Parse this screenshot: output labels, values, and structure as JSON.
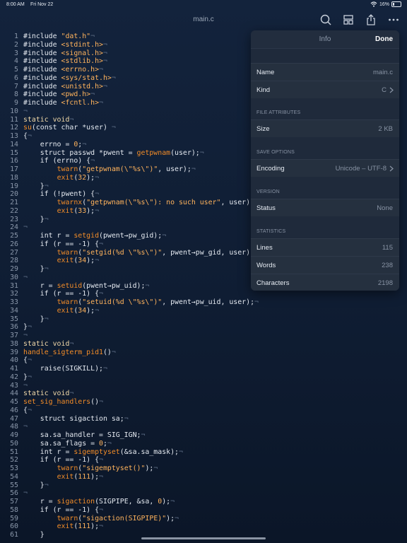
{
  "status_bar": {
    "time": "8:00 AM",
    "date": "Fri Nov 22",
    "battery": "16%",
    "battery_level": 0.16
  },
  "titlebar": {
    "title": "main.c",
    "icons": [
      "search-icon",
      "layout-icon",
      "share-icon",
      "more-icon"
    ]
  },
  "editor": {
    "lines": [
      [
        [
          "#include ",
          ""
        ],
        [
          "\"dat.h\"",
          "s"
        ],
        [
          "¬",
          "p"
        ]
      ],
      [
        [
          "#include ",
          ""
        ],
        [
          "<stdint.h>",
          "s"
        ],
        [
          "¬",
          "p"
        ]
      ],
      [
        [
          "#include ",
          ""
        ],
        [
          "<signal.h>",
          "s"
        ],
        [
          "¬",
          "p"
        ]
      ],
      [
        [
          "#include ",
          ""
        ],
        [
          "<stdlib.h>",
          "s"
        ],
        [
          "¬",
          "p"
        ]
      ],
      [
        [
          "#include ",
          ""
        ],
        [
          "<errno.h>",
          "s"
        ],
        [
          "¬",
          "p"
        ]
      ],
      [
        [
          "#include ",
          ""
        ],
        [
          "<sys/stat.h>",
          "s"
        ],
        [
          "¬",
          "p"
        ]
      ],
      [
        [
          "#include ",
          ""
        ],
        [
          "<unistd.h>",
          "s"
        ],
        [
          "¬",
          "p"
        ]
      ],
      [
        [
          "#include ",
          ""
        ],
        [
          "<pwd.h>",
          "s"
        ],
        [
          "¬",
          "p"
        ]
      ],
      [
        [
          "#include ",
          ""
        ],
        [
          "<fcntl.h>",
          "s"
        ],
        [
          "¬",
          "p"
        ]
      ],
      [
        [
          "¬",
          "p"
        ]
      ],
      [
        [
          "static void",
          "k"
        ],
        [
          "¬",
          "p"
        ]
      ],
      [
        [
          "su",
          "f"
        ],
        [
          "(const char *user) ",
          ""
        ],
        [
          "¬",
          "p"
        ]
      ],
      [
        [
          "{",
          ""
        ],
        [
          "¬",
          "p"
        ]
      ],
      [
        [
          "    errno = ",
          ""
        ],
        [
          "0",
          "s"
        ],
        [
          ";",
          ""
        ],
        [
          "¬",
          "p"
        ]
      ],
      [
        [
          "    struct passwd *pwent = ",
          ""
        ],
        [
          "getpwnam",
          "f"
        ],
        [
          "(user);",
          ""
        ],
        [
          "¬",
          "p"
        ]
      ],
      [
        [
          "    if (errno) {",
          ""
        ],
        [
          "¬",
          "p"
        ]
      ],
      [
        [
          "        ",
          ""
        ],
        [
          "twarn",
          "f"
        ],
        [
          "(",
          ""
        ],
        [
          "\"getpwnam(\\\"%s\\\")\"",
          "s"
        ],
        [
          ", user);",
          ""
        ],
        [
          "¬",
          "p"
        ]
      ],
      [
        [
          "        ",
          ""
        ],
        [
          "exit",
          "f"
        ],
        [
          "(",
          ""
        ],
        [
          "32",
          "s"
        ],
        [
          ");",
          ""
        ],
        [
          "¬",
          "p"
        ]
      ],
      [
        [
          "    }",
          ""
        ],
        [
          "¬",
          "p"
        ]
      ],
      [
        [
          "    if (!pwent) {",
          ""
        ],
        [
          "¬",
          "p"
        ]
      ],
      [
        [
          "        ",
          ""
        ],
        [
          "twarnx",
          "f"
        ],
        [
          "(",
          ""
        ],
        [
          "\"getpwnam(\\\"%s\\\"): no such user\"",
          "s"
        ],
        [
          ", user);",
          ""
        ]
      ],
      [
        [
          "        ",
          ""
        ],
        [
          "exit",
          "f"
        ],
        [
          "(",
          ""
        ],
        [
          "33",
          "s"
        ],
        [
          ");",
          ""
        ],
        [
          "¬",
          "p"
        ]
      ],
      [
        [
          "    }",
          ""
        ],
        [
          "¬",
          "p"
        ]
      ],
      [
        [
          "¬",
          "p"
        ]
      ],
      [
        [
          "    int r = ",
          ""
        ],
        [
          "setgid",
          "f"
        ],
        [
          "(pwent→pw_gid);",
          ""
        ],
        [
          "¬",
          "p"
        ]
      ],
      [
        [
          "    if (r == -1) {",
          ""
        ],
        [
          "¬",
          "p"
        ]
      ],
      [
        [
          "        ",
          ""
        ],
        [
          "twarn",
          "f"
        ],
        [
          "(",
          ""
        ],
        [
          "\"setgid(%d \\\"%s\\\")\"",
          "s"
        ],
        [
          ", pwent→pw_gid, user)",
          ""
        ]
      ],
      [
        [
          "        ",
          ""
        ],
        [
          "exit",
          "f"
        ],
        [
          "(",
          ""
        ],
        [
          "34",
          "s"
        ],
        [
          ");",
          ""
        ],
        [
          "¬",
          "p"
        ]
      ],
      [
        [
          "    }",
          ""
        ],
        [
          "¬",
          "p"
        ]
      ],
      [
        [
          "¬",
          "p"
        ]
      ],
      [
        [
          "    r = ",
          ""
        ],
        [
          "setuid",
          "f"
        ],
        [
          "(pwent→pw_uid);",
          ""
        ],
        [
          "¬",
          "p"
        ]
      ],
      [
        [
          "    if (r == -1) {",
          ""
        ],
        [
          "¬",
          "p"
        ]
      ],
      [
        [
          "        ",
          ""
        ],
        [
          "twarn",
          "f"
        ],
        [
          "(",
          ""
        ],
        [
          "\"setuid(%d \\\"%s\\\")\"",
          "s"
        ],
        [
          ", pwent→pw_uid, user);",
          ""
        ],
        [
          "¬",
          "p"
        ]
      ],
      [
        [
          "        ",
          ""
        ],
        [
          "exit",
          "f"
        ],
        [
          "(",
          ""
        ],
        [
          "34",
          "s"
        ],
        [
          ");",
          ""
        ],
        [
          "¬",
          "p"
        ]
      ],
      [
        [
          "    }",
          ""
        ],
        [
          "¬",
          "p"
        ]
      ],
      [
        [
          "}",
          ""
        ],
        [
          "¬",
          "p"
        ]
      ],
      [
        [
          "¬",
          "p"
        ]
      ],
      [
        [
          "static void",
          "k"
        ],
        [
          "¬",
          "p"
        ]
      ],
      [
        [
          "handle_sigterm_pid1",
          "f"
        ],
        [
          "()",
          ""
        ],
        [
          "¬",
          "p"
        ]
      ],
      [
        [
          "{",
          ""
        ],
        [
          "¬",
          "p"
        ]
      ],
      [
        [
          "    raise(SIGKILL);",
          ""
        ],
        [
          "¬",
          "p"
        ]
      ],
      [
        [
          "}",
          ""
        ],
        [
          "¬",
          "p"
        ]
      ],
      [
        [
          "¬",
          "p"
        ]
      ],
      [
        [
          "static void",
          "k"
        ],
        [
          "¬",
          "p"
        ]
      ],
      [
        [
          "set_sig_handlers",
          "f"
        ],
        [
          "()",
          ""
        ],
        [
          "¬",
          "p"
        ]
      ],
      [
        [
          "{",
          ""
        ],
        [
          "¬",
          "p"
        ]
      ],
      [
        [
          "    struct sigaction sa;",
          ""
        ],
        [
          "¬",
          "p"
        ]
      ],
      [
        [
          "¬",
          "p"
        ]
      ],
      [
        [
          "    sa.sa_handler = SIG_IGN;",
          ""
        ],
        [
          "¬",
          "p"
        ]
      ],
      [
        [
          "    sa.sa_flags = ",
          ""
        ],
        [
          "0",
          "s"
        ],
        [
          ";",
          ""
        ],
        [
          "¬",
          "p"
        ]
      ],
      [
        [
          "    int r = ",
          ""
        ],
        [
          "sigemptyset",
          "f"
        ],
        [
          "(&sa.sa_mask);",
          ""
        ],
        [
          "¬",
          "p"
        ]
      ],
      [
        [
          "    if (r == -1) {",
          ""
        ],
        [
          "¬",
          "p"
        ]
      ],
      [
        [
          "        ",
          ""
        ],
        [
          "twarn",
          "f"
        ],
        [
          "(",
          ""
        ],
        [
          "\"sigemptyset()\"",
          "s"
        ],
        [
          ");",
          ""
        ],
        [
          "¬",
          "p"
        ]
      ],
      [
        [
          "        ",
          ""
        ],
        [
          "exit",
          "f"
        ],
        [
          "(",
          ""
        ],
        [
          "111",
          "s"
        ],
        [
          ");",
          ""
        ],
        [
          "¬",
          "p"
        ]
      ],
      [
        [
          "    }",
          ""
        ],
        [
          "¬",
          "p"
        ]
      ],
      [
        [
          "¬",
          "p"
        ]
      ],
      [
        [
          "    r = ",
          ""
        ],
        [
          "sigaction",
          "f"
        ],
        [
          "(SIGPIPE, &sa, ",
          ""
        ],
        [
          "0",
          "s"
        ],
        [
          ");",
          ""
        ],
        [
          "¬",
          "p"
        ]
      ],
      [
        [
          "    if (r == -1) {",
          ""
        ],
        [
          "¬",
          "p"
        ]
      ],
      [
        [
          "        ",
          ""
        ],
        [
          "twarn",
          "f"
        ],
        [
          "(",
          ""
        ],
        [
          "\"sigaction(SIGPIPE)\"",
          "s"
        ],
        [
          ");",
          ""
        ],
        [
          "¬",
          "p"
        ]
      ],
      [
        [
          "        ",
          ""
        ],
        [
          "exit",
          "f"
        ],
        [
          "(",
          ""
        ],
        [
          "111",
          "s"
        ],
        [
          ");",
          ""
        ],
        [
          "¬",
          "p"
        ]
      ],
      [
        [
          "    }",
          ""
        ]
      ]
    ]
  },
  "info_panel": {
    "header": {
      "title": "Info",
      "done_label": "Done"
    },
    "name": {
      "label": "Name",
      "value": "main.c"
    },
    "kind": {
      "label": "Kind",
      "value": "C"
    },
    "file_attributes": {
      "section": "FILE ATTRIBUTES",
      "size_label": "Size",
      "size_value": "2 KB"
    },
    "save_options": {
      "section": "SAVE OPTIONS",
      "encoding_label": "Encoding",
      "encoding_value": "Unicode – UTF-8"
    },
    "version": {
      "section": "VERSION",
      "status_label": "Status",
      "status_value": "None"
    },
    "statistics": {
      "section": "STATISTICS",
      "lines_label": "Lines",
      "lines_value": "115",
      "words_label": "Words",
      "words_value": "238",
      "characters_label": "Characters",
      "characters_value": "2198"
    }
  }
}
